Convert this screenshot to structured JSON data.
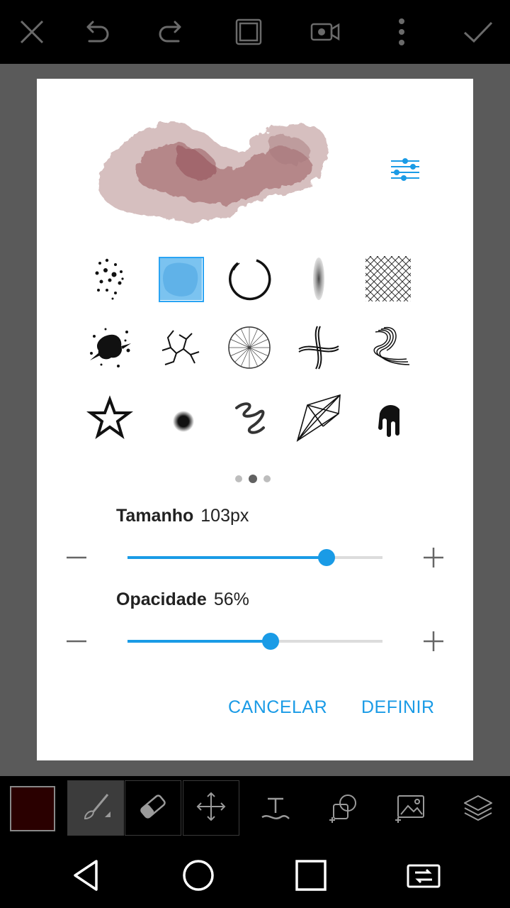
{
  "topbar": {
    "icons": [
      "close-icon",
      "undo-icon",
      "redo-icon",
      "fullscreen-icon",
      "video-camera-icon",
      "more-vert-icon",
      "check-icon"
    ]
  },
  "dialog": {
    "brushes_page_indicator": {
      "pages": 3,
      "active": 2
    },
    "size": {
      "label": "Tamanho",
      "value": "103px",
      "level": 0.78
    },
    "opacity": {
      "label": "Opacidade",
      "value": "56%",
      "level": 0.56
    },
    "cancel_label": "CANCELAR",
    "confirm_label": "DEFINIR",
    "accent_color": "#1a9be6",
    "brushes": [
      "dots-brush",
      "watercolor-brush",
      "ring-brush",
      "airbrush-brush",
      "crosshatch-brush",
      "splatter-brush",
      "cracks-brush",
      "circle-sketch-brush",
      "ribbon-brush",
      "wave-lines-brush",
      "star-brush",
      "soft-dot-brush",
      "scribble-brush",
      "geometric-brush",
      "drip-brush"
    ],
    "selected_brush": "watercolor-brush"
  },
  "bottombar": {
    "current_color": "#2a0000",
    "tools": [
      "brush-icon",
      "eraser-icon",
      "move-icon",
      "text-icon",
      "shape-add-icon",
      "image-add-icon",
      "layers-icon"
    ]
  },
  "navbar": {
    "icons": [
      "back-icon",
      "home-icon",
      "recents-icon",
      "switch-app-icon"
    ]
  }
}
